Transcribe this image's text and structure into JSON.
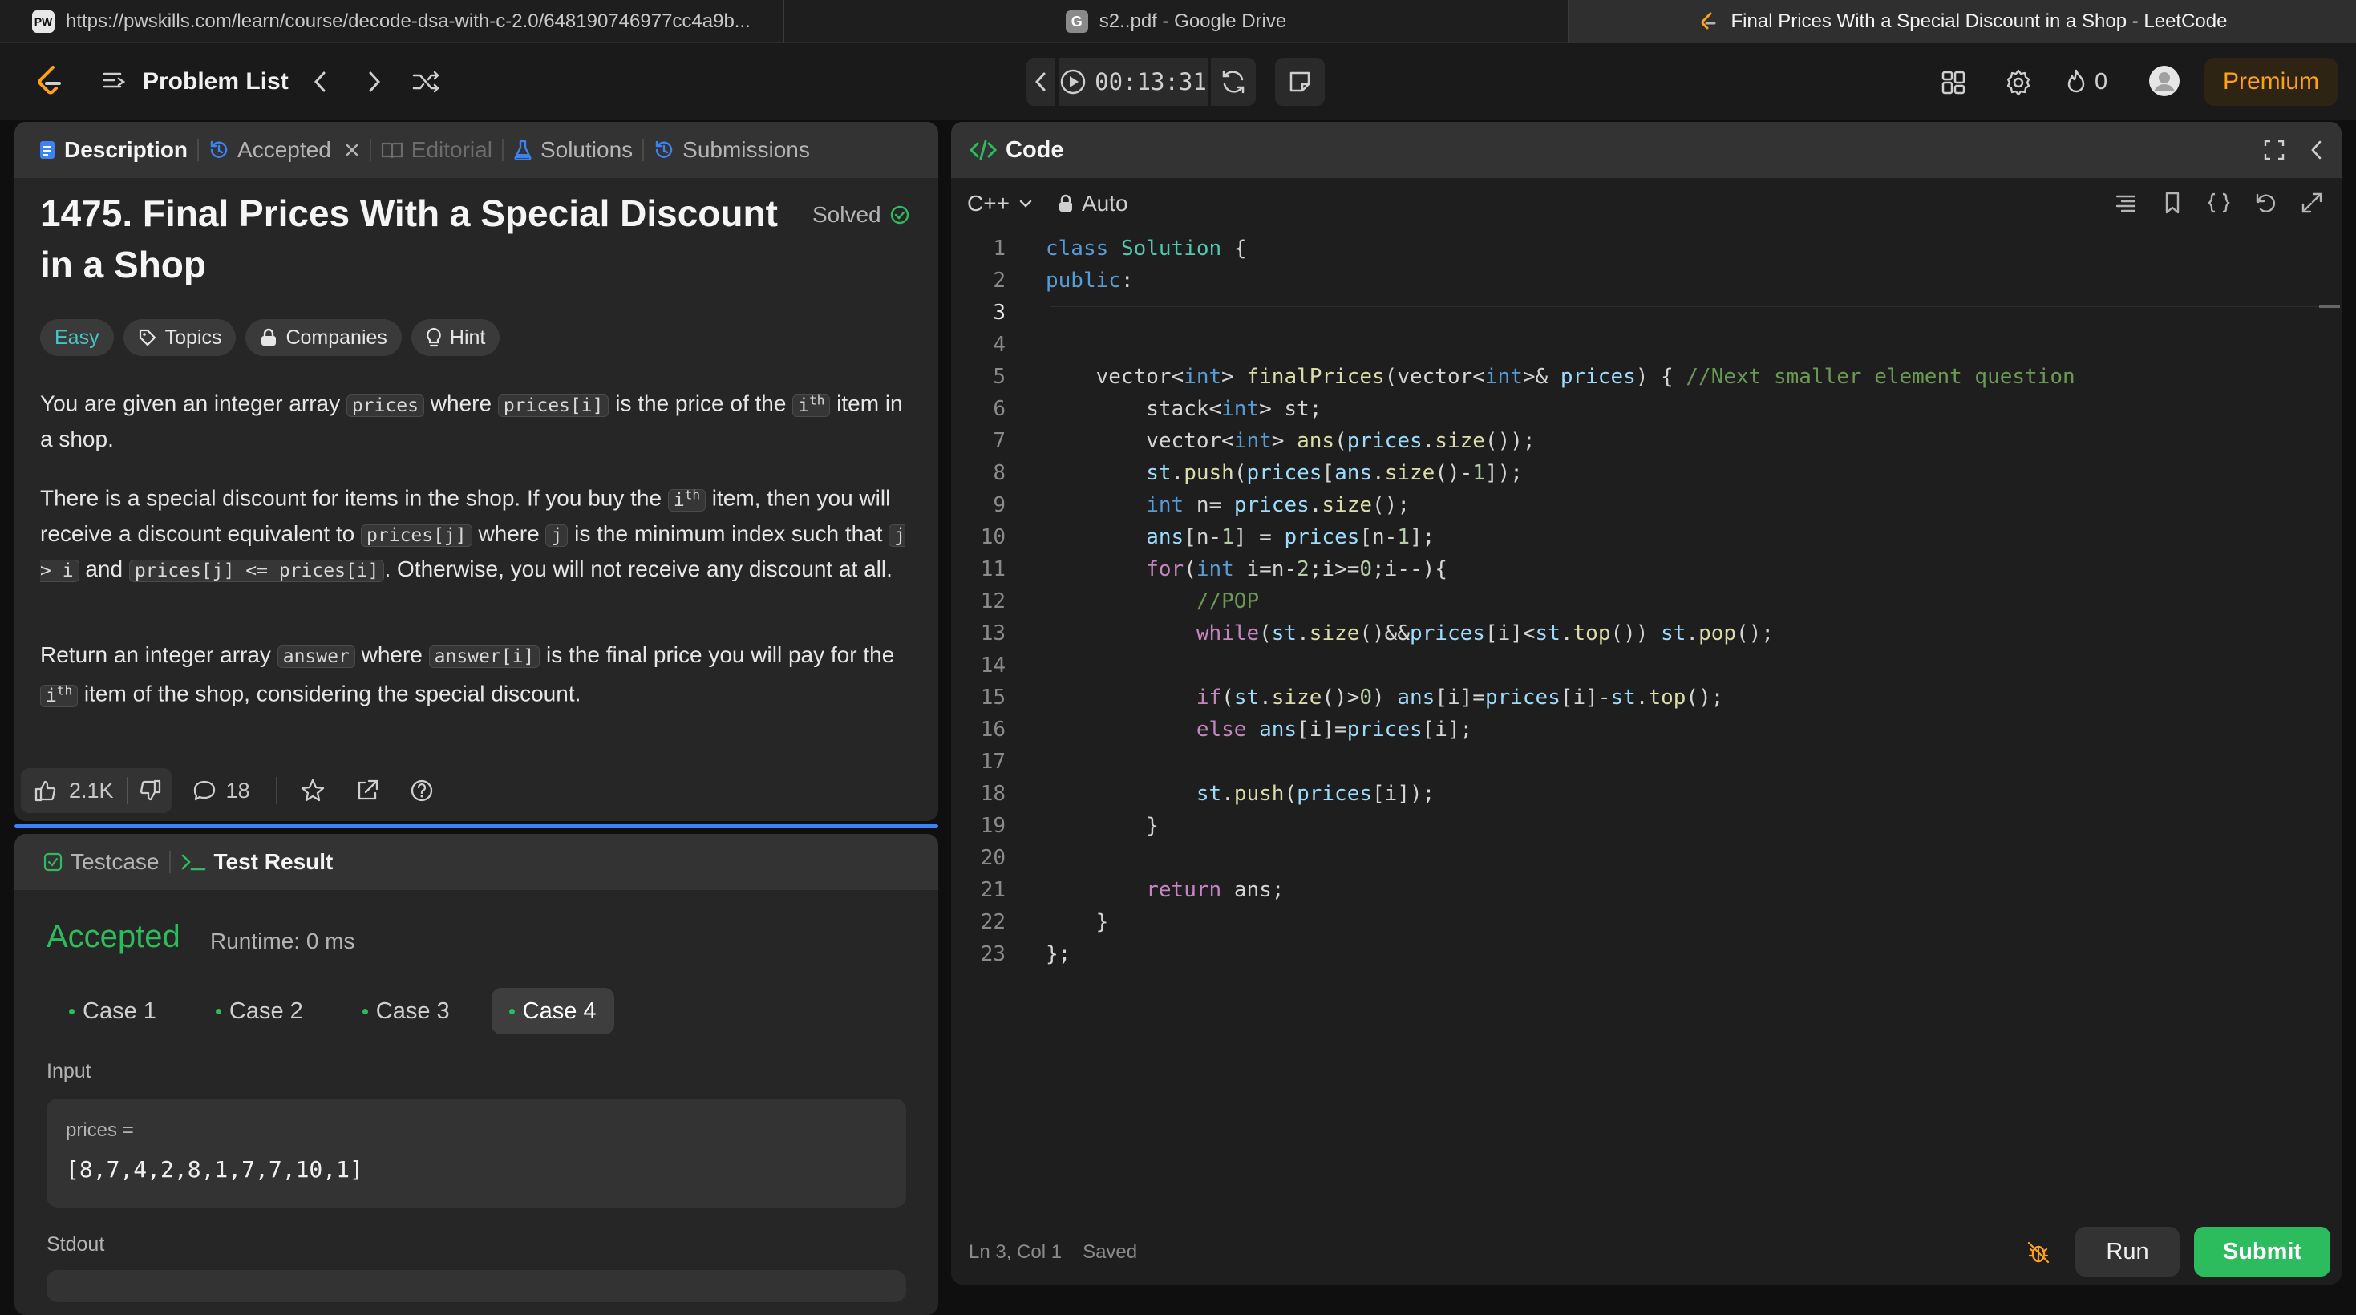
{
  "browser_tabs": [
    {
      "title": "https://pwskills.com/learn/course/decode-dsa-with-c-2.0/648190746977cc4a9b...",
      "favicon": "pw"
    },
    {
      "title": "s2..pdf - Google Drive",
      "favicon": "G"
    },
    {
      "title": "Final Prices With a Special Discount in a Shop - LeetCode",
      "favicon": "leetcode"
    }
  ],
  "nav": {
    "problem_list": "Problem List",
    "timer": "00:13:31",
    "streak": "0",
    "premium": "Premium"
  },
  "description_panel": {
    "tabs": [
      "Description",
      "Accepted",
      "Editorial",
      "Solutions",
      "Submissions"
    ],
    "title_line1": "1475. Final Prices With a Special Discount",
    "title_line2": "in a Shop",
    "status": "Solved",
    "chips": [
      "Easy",
      "Topics",
      "Companies",
      "Hint"
    ],
    "p1": {
      "t1": "You are given an integer array",
      "c1": "prices",
      "t2": "where",
      "c2": "prices[i]",
      "t3": "is the price of the",
      "c3": "i",
      "sup3": "th",
      "t4": "item",
      "t5": "in a shop."
    },
    "p2": {
      "t1": "There is a special discount for items in the shop. If you buy the",
      "c1": "i",
      "sup1": "th",
      "t2": "item, then you",
      "t3": "will receive a discount equivalent to",
      "c2": "prices[j]",
      "t4": "where",
      "c3": "j",
      "t5": "is the minimum index such",
      "t6": "that",
      "c4": "j > i",
      "t7": "and",
      "c5": "prices[j] <= prices[i]",
      "t8": ". Otherwise, you will not receive any",
      "t9": "discount at all."
    },
    "p3": {
      "t1": "Return an integer array",
      "c1": "answer",
      "t2": "where",
      "c2": "answer[i]",
      "t3": "is the final price you will pay for",
      "t4": "the",
      "c3": "i",
      "sup3": "th",
      "t5": "item of the shop, considering the special discount."
    },
    "likes": "2.1K",
    "comments": "18"
  },
  "test_panel": {
    "tabs": [
      "Testcase",
      "Test Result"
    ],
    "result": "Accepted",
    "runtime": "Runtime: 0 ms",
    "cases": [
      "Case 1",
      "Case 2",
      "Case 3",
      "Case 4"
    ],
    "selected_case": "Case 4",
    "input_label": "Input",
    "var_name": "prices =",
    "var_value": "[8,7,4,2,8,1,7,7,10,1]",
    "stdout_label": "Stdout"
  },
  "code_panel": {
    "title": "Code",
    "language": "C++",
    "mode": "Auto",
    "cursor": "Ln 3, Col 1",
    "save_state": "Saved",
    "run": "Run",
    "submit": "Submit",
    "lines": [
      "class Solution {",
      "public:",
      "",
      "",
      "    vector<int> finalPrices(vector<int>& prices) { //Next smaller element question",
      "        stack<int> st;",
      "        vector<int> ans(prices.size());",
      "        st.push(prices[ans.size()-1]);",
      "        int n= prices.size();",
      "        ans[n-1] = prices[n-1];",
      "        for(int i=n-2;i>=0;i--){",
      "            //POP",
      "            while(st.size()&&prices[i]<st.top()) st.pop();",
      "",
      "            if(st.size()>0) ans[i]=prices[i]-st.top();",
      "            else ans[i]=prices[i];",
      "",
      "            st.push(prices[i]);",
      "        }",
      "",
      "        return ans;",
      "    }",
      "};"
    ]
  }
}
